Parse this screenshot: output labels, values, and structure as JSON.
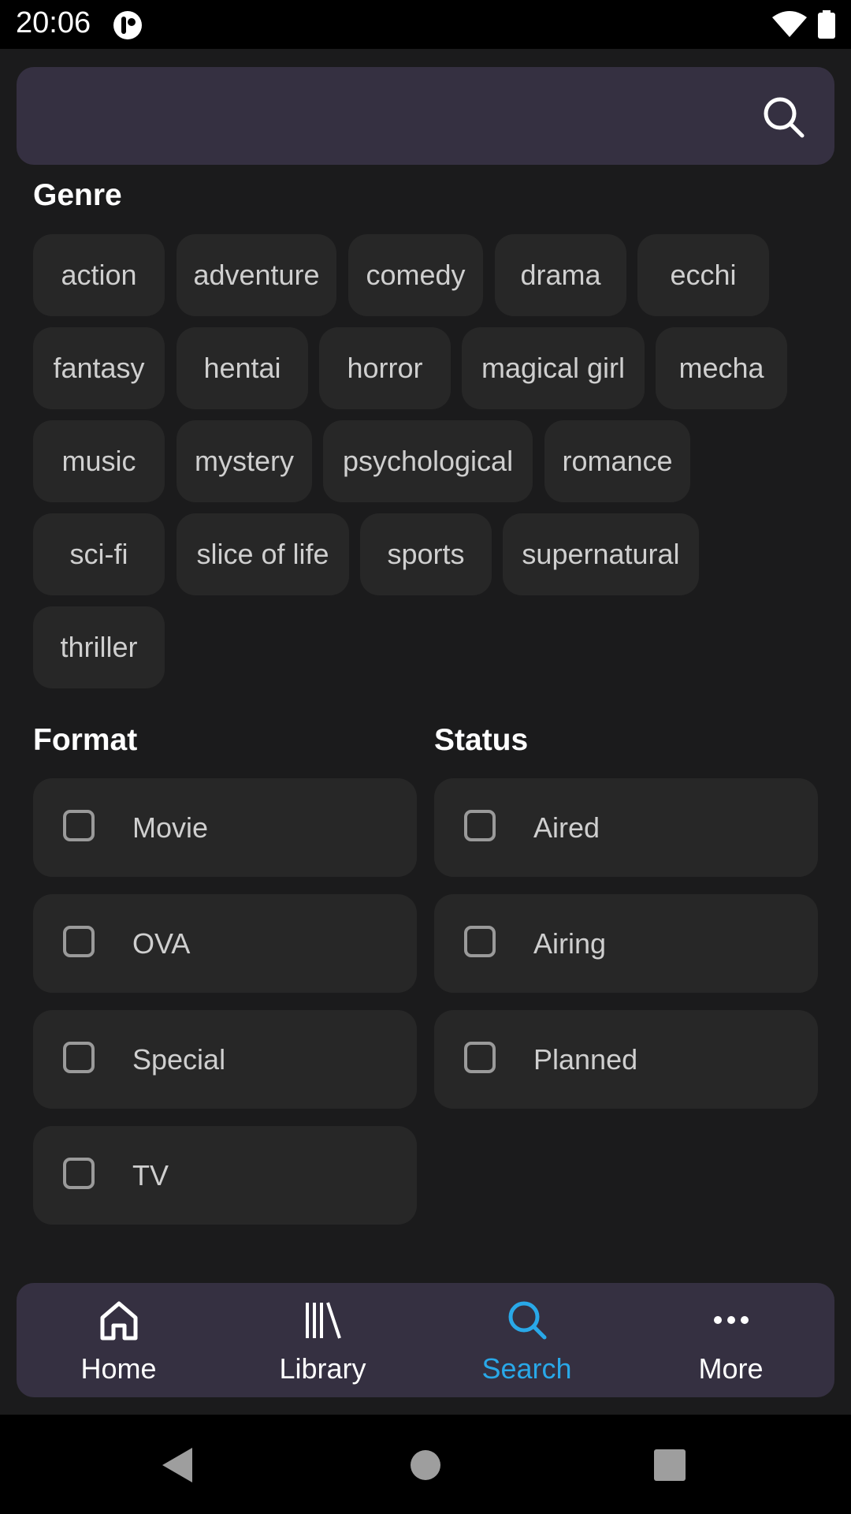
{
  "status_bar": {
    "time": "20:06"
  },
  "search": {
    "placeholder": "",
    "value": ""
  },
  "genre": {
    "title": "Genre",
    "chips": [
      "action",
      "adventure",
      "comedy",
      "drama",
      "ecchi",
      "fantasy",
      "hentai",
      "horror",
      "magical girl",
      "mecha",
      "music",
      "mystery",
      "psychological",
      "romance",
      "sci-fi",
      "slice of life",
      "sports",
      "supernatural",
      "thriller"
    ]
  },
  "format": {
    "title": "Format",
    "options": [
      {
        "label": "Movie",
        "checked": false
      },
      {
        "label": "OVA",
        "checked": false
      },
      {
        "label": "Special",
        "checked": false
      },
      {
        "label": "TV",
        "checked": false
      }
    ]
  },
  "status": {
    "title": "Status",
    "options": [
      {
        "label": "Aired",
        "checked": false
      },
      {
        "label": "Airing",
        "checked": false
      },
      {
        "label": "Planned",
        "checked": false
      }
    ]
  },
  "bottom_nav": {
    "active": "Search",
    "active_color": "#29a8e8",
    "items": [
      {
        "label": "Home",
        "icon": "home-icon"
      },
      {
        "label": "Library",
        "icon": "library-icon"
      },
      {
        "label": "Search",
        "icon": "search-icon"
      },
      {
        "label": "More",
        "icon": "more-icon"
      }
    ]
  }
}
